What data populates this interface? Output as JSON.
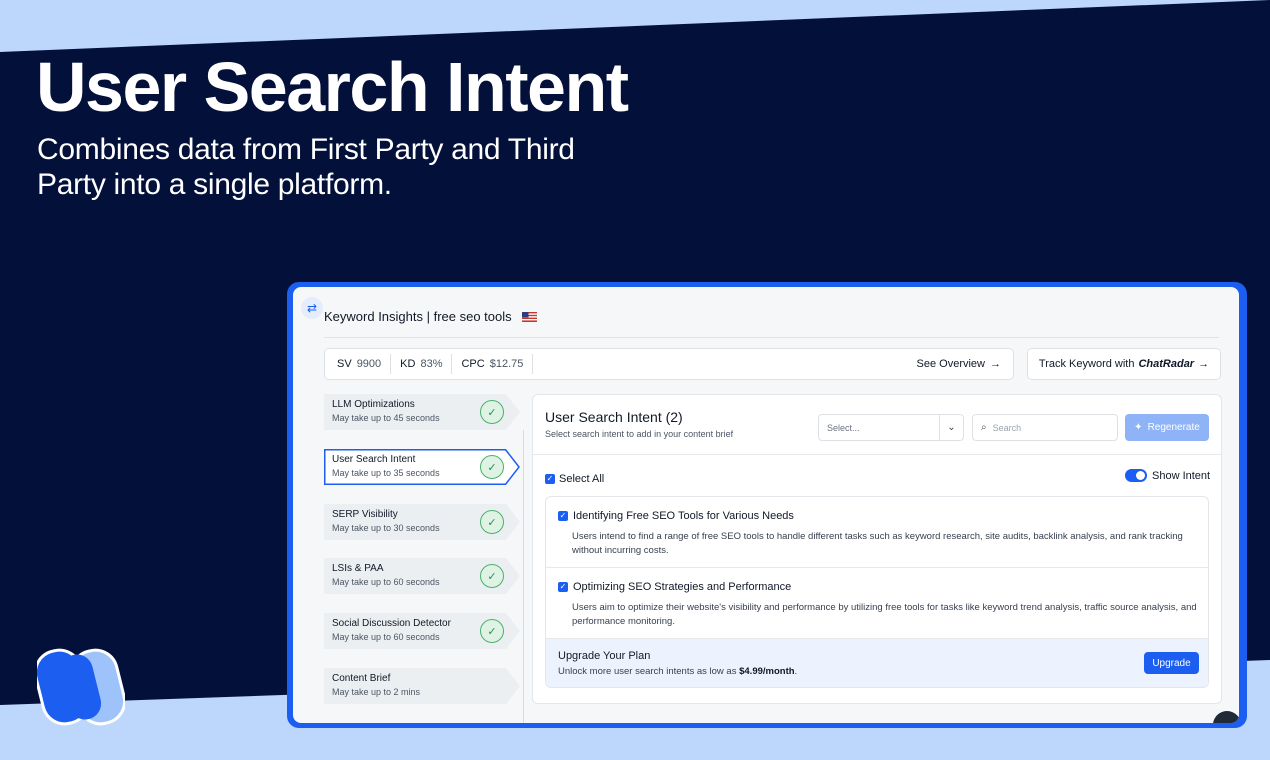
{
  "hero": {
    "title": "User Search Intent",
    "subtitle": "Combines data from First Party and Third Party into a single platform."
  },
  "colors": {
    "navy": "#03113a",
    "light_blue": "#bcd7fb",
    "accent": "#1b5ef0",
    "success": "#4caf6e"
  },
  "header": {
    "title": "Keyword Insights | free seo tools",
    "flag_icon": "us-flag-icon",
    "swap_icon": "swap-arrows-icon"
  },
  "stats": {
    "sv_label": "SV",
    "sv_value": "9900",
    "kd_label": "KD",
    "kd_value": "83%",
    "cpc_label": "CPC",
    "cpc_value": "$12.75",
    "see_overview": "See Overview",
    "arrow": "→"
  },
  "track": {
    "prefix": "Track Keyword with",
    "brand": "ChatRadar",
    "arrow": "→"
  },
  "steps": [
    {
      "title": "LLM Optimizations",
      "subtitle": "May take up to 45 seconds",
      "done": true,
      "active": false
    },
    {
      "title": "User Search Intent",
      "subtitle": "May take up to 35 seconds",
      "done": true,
      "active": true
    },
    {
      "title": "SERP Visibility",
      "subtitle": "May take up to 30 seconds",
      "done": true,
      "active": false
    },
    {
      "title": "LSIs & PAA",
      "subtitle": "May take up to 60 seconds",
      "done": true,
      "active": false
    },
    {
      "title": "Social Discussion Detector",
      "subtitle": "May take up to 60 seconds",
      "done": true,
      "active": false
    },
    {
      "title": "Content Brief",
      "subtitle": "May take up to 2 mins",
      "done": false,
      "active": false
    }
  ],
  "panel": {
    "title": "User Search Intent (2)",
    "subtitle": "Select search intent to add in your content brief",
    "select_placeholder": "Select...",
    "search_placeholder": "Search",
    "regenerate_label": "Regenerate",
    "select_all_label": "Select All",
    "show_intent_label": "Show Intent",
    "show_intent_on": true
  },
  "intents": [
    {
      "title": "Identifying Free SEO Tools for Various Needs",
      "description": "Users intend to find a range of free SEO tools to handle different tasks such as keyword research, site audits, backlink analysis, and rank tracking without incurring costs.",
      "checked": true
    },
    {
      "title": "Optimizing SEO Strategies and Performance",
      "description": "Users aim to optimize their website's visibility and performance by utilizing free tools for tasks like keyword trend analysis, traffic source analysis, and performance monitoring.",
      "checked": true
    }
  ],
  "upgrade": {
    "title": "Upgrade Your Plan",
    "text": "Unlock more user search intents as low as",
    "price": "$4.99/month",
    "period": ".",
    "button": "Upgrade"
  }
}
